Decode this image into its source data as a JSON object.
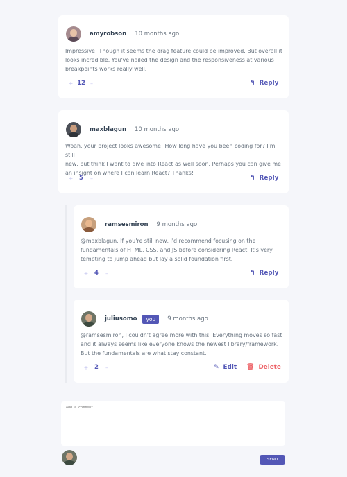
{
  "comments": [
    {
      "username": "amyrobson",
      "time": "10 months ago",
      "content_lines": [
        "Impressive! Though it seems the drag feature could be improved. But overall it",
        "looks incredible. You've nailed the design and the responsiveness at various",
        "breakpoints works really well."
      ],
      "score": "12",
      "reply_label": "Reply"
    },
    {
      "username": "maxblagun",
      "time": "10 months ago",
      "content_lines": [
        "Woah, your project looks awesome! How long have you been coding for? I'm still",
        "new, but think I want to dive into React as well soon. Perhaps you can give me",
        "an insight on where I can learn React? Thanks!"
      ],
      "score": "5",
      "reply_label": "Reply"
    }
  ],
  "replies": [
    {
      "username": "ramsesmiron",
      "time": "9 months ago",
      "content_lines": [
        "@maxblagun, If you're still new, I'd recommend focusing on the",
        "fundamentals of HTML, CSS, and JS before considering React. It's very",
        "tempting to jump ahead but lay a solid foundation first."
      ],
      "score": "4",
      "reply_label": "Reply"
    },
    {
      "username": "juliusomo",
      "you_badge": "you",
      "time": "9 months ago",
      "content_lines": [
        "@ramsesmiron, I couldn't agree more with this. Everything moves so fast",
        "and it always seems like everyone knows the newest library/framework.",
        "But the fundamentals are what stay constant."
      ],
      "score": "2",
      "edit_label": "Edit",
      "delete_label": "Delete"
    }
  ],
  "compose": {
    "placeholder": "Add a comment...",
    "send_label": "SEND"
  },
  "icons": {
    "upvote": "plus-icon",
    "downvote": "minus-icon",
    "reply": "reply-icon",
    "edit": "pencil-icon",
    "delete": "trash-icon"
  },
  "colors": {
    "accent": "#5357b6",
    "danger": "#ed6368",
    "background": "#f5f6fa",
    "heading": "#334253",
    "muted": "#67727e"
  }
}
